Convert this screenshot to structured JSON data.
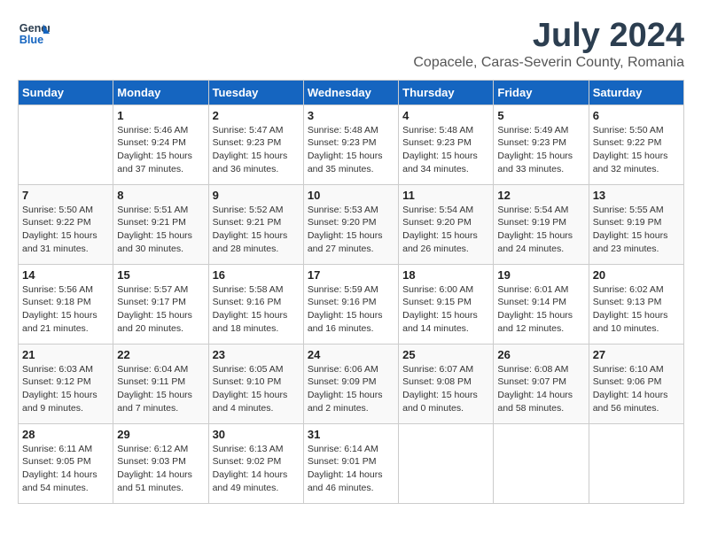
{
  "logo": {
    "line1": "General",
    "line2": "Blue"
  },
  "title": "July 2024",
  "location": "Copacele, Caras-Severin County, Romania",
  "weekdays": [
    "Sunday",
    "Monday",
    "Tuesday",
    "Wednesday",
    "Thursday",
    "Friday",
    "Saturday"
  ],
  "weeks": [
    [
      {
        "day": "",
        "info": ""
      },
      {
        "day": "1",
        "info": "Sunrise: 5:46 AM\nSunset: 9:24 PM\nDaylight: 15 hours\nand 37 minutes."
      },
      {
        "day": "2",
        "info": "Sunrise: 5:47 AM\nSunset: 9:23 PM\nDaylight: 15 hours\nand 36 minutes."
      },
      {
        "day": "3",
        "info": "Sunrise: 5:48 AM\nSunset: 9:23 PM\nDaylight: 15 hours\nand 35 minutes."
      },
      {
        "day": "4",
        "info": "Sunrise: 5:48 AM\nSunset: 9:23 PM\nDaylight: 15 hours\nand 34 minutes."
      },
      {
        "day": "5",
        "info": "Sunrise: 5:49 AM\nSunset: 9:23 PM\nDaylight: 15 hours\nand 33 minutes."
      },
      {
        "day": "6",
        "info": "Sunrise: 5:50 AM\nSunset: 9:22 PM\nDaylight: 15 hours\nand 32 minutes."
      }
    ],
    [
      {
        "day": "7",
        "info": "Sunrise: 5:50 AM\nSunset: 9:22 PM\nDaylight: 15 hours\nand 31 minutes."
      },
      {
        "day": "8",
        "info": "Sunrise: 5:51 AM\nSunset: 9:21 PM\nDaylight: 15 hours\nand 30 minutes."
      },
      {
        "day": "9",
        "info": "Sunrise: 5:52 AM\nSunset: 9:21 PM\nDaylight: 15 hours\nand 28 minutes."
      },
      {
        "day": "10",
        "info": "Sunrise: 5:53 AM\nSunset: 9:20 PM\nDaylight: 15 hours\nand 27 minutes."
      },
      {
        "day": "11",
        "info": "Sunrise: 5:54 AM\nSunset: 9:20 PM\nDaylight: 15 hours\nand 26 minutes."
      },
      {
        "day": "12",
        "info": "Sunrise: 5:54 AM\nSunset: 9:19 PM\nDaylight: 15 hours\nand 24 minutes."
      },
      {
        "day": "13",
        "info": "Sunrise: 5:55 AM\nSunset: 9:19 PM\nDaylight: 15 hours\nand 23 minutes."
      }
    ],
    [
      {
        "day": "14",
        "info": "Sunrise: 5:56 AM\nSunset: 9:18 PM\nDaylight: 15 hours\nand 21 minutes."
      },
      {
        "day": "15",
        "info": "Sunrise: 5:57 AM\nSunset: 9:17 PM\nDaylight: 15 hours\nand 20 minutes."
      },
      {
        "day": "16",
        "info": "Sunrise: 5:58 AM\nSunset: 9:16 PM\nDaylight: 15 hours\nand 18 minutes."
      },
      {
        "day": "17",
        "info": "Sunrise: 5:59 AM\nSunset: 9:16 PM\nDaylight: 15 hours\nand 16 minutes."
      },
      {
        "day": "18",
        "info": "Sunrise: 6:00 AM\nSunset: 9:15 PM\nDaylight: 15 hours\nand 14 minutes."
      },
      {
        "day": "19",
        "info": "Sunrise: 6:01 AM\nSunset: 9:14 PM\nDaylight: 15 hours\nand 12 minutes."
      },
      {
        "day": "20",
        "info": "Sunrise: 6:02 AM\nSunset: 9:13 PM\nDaylight: 15 hours\nand 10 minutes."
      }
    ],
    [
      {
        "day": "21",
        "info": "Sunrise: 6:03 AM\nSunset: 9:12 PM\nDaylight: 15 hours\nand 9 minutes."
      },
      {
        "day": "22",
        "info": "Sunrise: 6:04 AM\nSunset: 9:11 PM\nDaylight: 15 hours\nand 7 minutes."
      },
      {
        "day": "23",
        "info": "Sunrise: 6:05 AM\nSunset: 9:10 PM\nDaylight: 15 hours\nand 4 minutes."
      },
      {
        "day": "24",
        "info": "Sunrise: 6:06 AM\nSunset: 9:09 PM\nDaylight: 15 hours\nand 2 minutes."
      },
      {
        "day": "25",
        "info": "Sunrise: 6:07 AM\nSunset: 9:08 PM\nDaylight: 15 hours\nand 0 minutes."
      },
      {
        "day": "26",
        "info": "Sunrise: 6:08 AM\nSunset: 9:07 PM\nDaylight: 14 hours\nand 58 minutes."
      },
      {
        "day": "27",
        "info": "Sunrise: 6:10 AM\nSunset: 9:06 PM\nDaylight: 14 hours\nand 56 minutes."
      }
    ],
    [
      {
        "day": "28",
        "info": "Sunrise: 6:11 AM\nSunset: 9:05 PM\nDaylight: 14 hours\nand 54 minutes."
      },
      {
        "day": "29",
        "info": "Sunrise: 6:12 AM\nSunset: 9:03 PM\nDaylight: 14 hours\nand 51 minutes."
      },
      {
        "day": "30",
        "info": "Sunrise: 6:13 AM\nSunset: 9:02 PM\nDaylight: 14 hours\nand 49 minutes."
      },
      {
        "day": "31",
        "info": "Sunrise: 6:14 AM\nSunset: 9:01 PM\nDaylight: 14 hours\nand 46 minutes."
      },
      {
        "day": "",
        "info": ""
      },
      {
        "day": "",
        "info": ""
      },
      {
        "day": "",
        "info": ""
      }
    ]
  ]
}
